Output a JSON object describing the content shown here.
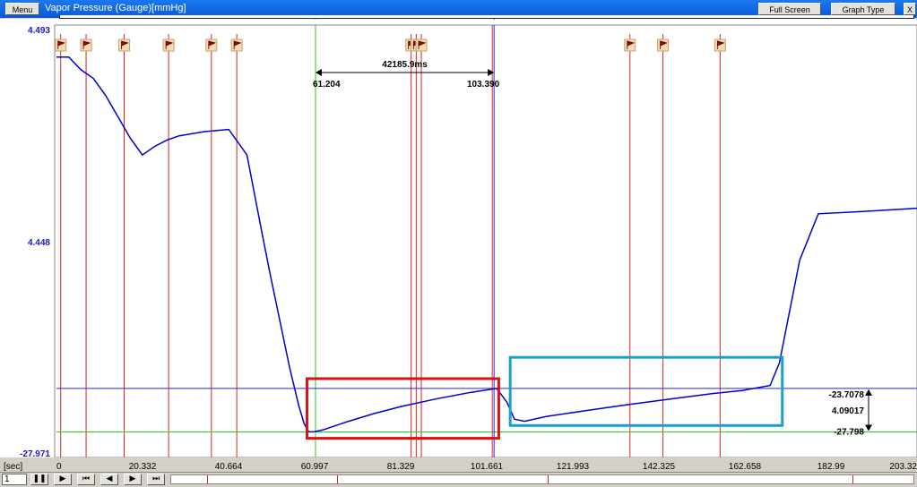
{
  "window": {
    "menu_label": "Menu",
    "title": "Vapor Pressure (Gauge)[mmHg]",
    "full_screen_label": "Full Screen",
    "graph_type_label": "Graph Type",
    "close_label": "X"
  },
  "chart_data": {
    "type": "line",
    "title": "Vapor Pressure (Gauge)[mmHg]",
    "xlabel": "[sec]",
    "ylabel": "",
    "xlim": [
      0,
      203.32
    ],
    "y_tick_labels": [
      "4.493",
      "4.448",
      "-27.971"
    ],
    "x_tick_labels": [
      "0",
      "20.332",
      "40.664",
      "60.997",
      "81.329",
      "101.661",
      "121.993",
      "142.325",
      "162.658",
      "182.99",
      "203.32"
    ],
    "series": [
      {
        "color": "#0000cc",
        "x": [
          0,
          2.9,
          5.8,
          8.7,
          11.6,
          14.5,
          17.4,
          20.3,
          23.2,
          26.1,
          29,
          35,
          40.7,
          45,
          48.5,
          50.5,
          52.8,
          55.1,
          57.3,
          58.5,
          59.6,
          60.8,
          63,
          69,
          75,
          81.6,
          90,
          98,
          104,
          106.4,
          108.2,
          110.6,
          115.7,
          125,
          135,
          145,
          155,
          162,
          168.6,
          170.8,
          175.6,
          180,
          190,
          203.3
        ],
        "y": [
          4.486,
          4.486,
          4.483,
          4.481,
          4.477,
          4.472,
          4.467,
          4.463,
          4.465,
          4.4665,
          4.4675,
          4.4685,
          4.469,
          4.463,
          4.445,
          4.435,
          4.424,
          4.413,
          4.404,
          4.4,
          4.398,
          4.398,
          4.3985,
          4.4005,
          4.4023,
          4.404,
          4.4058,
          4.4073,
          4.4082,
          4.405,
          4.401,
          4.4005,
          4.4016,
          4.403,
          4.4044,
          4.4057,
          4.407,
          4.4077,
          4.4089,
          4.4142,
          4.4383,
          4.4492,
          4.4497,
          4.4505
        ]
      }
    ],
    "event_markers_x": [
      1.0,
      7.0,
      16.0,
      26.5,
      36.6,
      42.6,
      83.8,
      85.0,
      86.2,
      135.5,
      143.3,
      156.8
    ],
    "cursor_green": {
      "x": 61.204,
      "y": 4.398
    },
    "cursor_blue": {
      "x": 103.39,
      "y": 4.4082
    },
    "delta_label": "42185.9ms",
    "cursor_label_left": "61.204",
    "cursor_label_right": "103.390",
    "right_labels": [
      "-23.7078",
      "4.09017",
      "-27.798"
    ],
    "highlight_boxes": [
      {
        "color": "#dd1111",
        "x": [
          59.2,
          104.5
        ],
        "y": [
          4.3965,
          4.4105
        ]
      },
      {
        "color": "#1aa0c8",
        "x": [
          107.2,
          171.5
        ],
        "y": [
          4.3995,
          4.4155
        ]
      }
    ]
  },
  "controls": {
    "spin_value": "1"
  }
}
